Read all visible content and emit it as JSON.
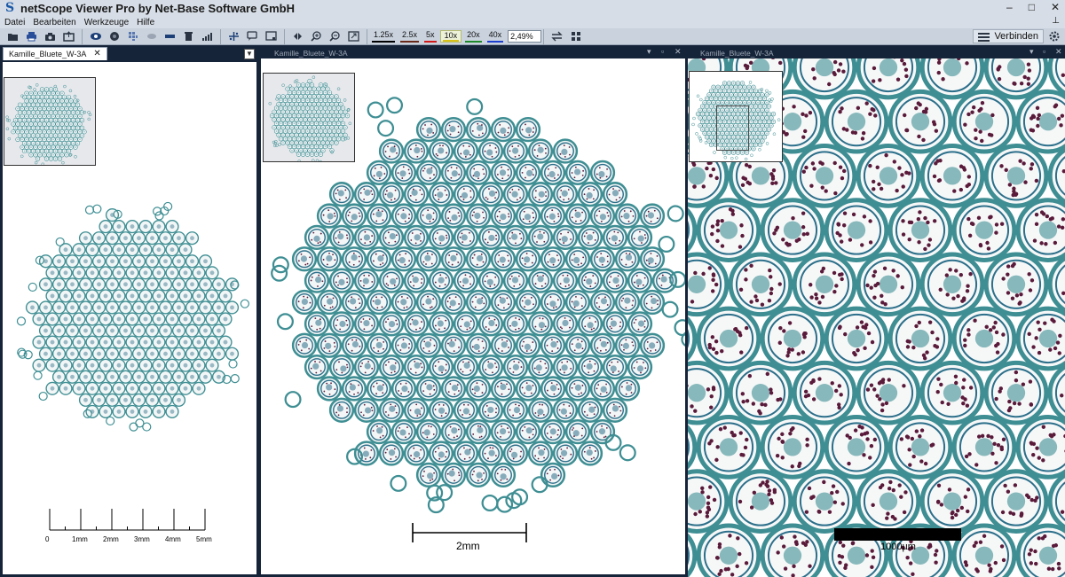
{
  "app": {
    "title": "netScope Viewer Pro by Net-Base Software GmbH",
    "logo_letter": "S",
    "window_buttons": [
      "–",
      "□",
      "✕"
    ]
  },
  "menu": [
    "Datei",
    "Bearbeiten",
    "Werkzeuge",
    "Hilfe"
  ],
  "toolbar": {
    "zoom_levels": [
      {
        "label": "1.25x",
        "color": "#000000",
        "active": false
      },
      {
        "label": "2.5x",
        "color": "#6a2a1a",
        "active": false
      },
      {
        "label": "5x",
        "color": "#d11b1b",
        "active": false
      },
      {
        "label": "10x",
        "color": "#d8c21a",
        "active": true
      },
      {
        "label": "20x",
        "color": "#1f8a2a",
        "active": false
      },
      {
        "label": "40x",
        "color": "#1d3fd0",
        "active": false
      }
    ],
    "zoom_value": "2,49%",
    "connect_label": "Verbinden",
    "icons": [
      "folder-icon",
      "print-icon",
      "camera-icon",
      "export-icon",
      "eye-icon",
      "circle-icon",
      "grid-icon",
      "layers-icon",
      "bar-icon",
      "trash-icon",
      "chart-icon",
      "move-icon",
      "annotate-icon",
      "crop-icon",
      "rotate-icon",
      "zoom-in-icon",
      "zoom-out-icon",
      "fit-icon",
      "swap-icon",
      "layout-icon",
      "connect-icon",
      "settings-icon"
    ]
  },
  "panels": {
    "left": {
      "tab_label": "Kamille_Bluete_W-3A",
      "scale_labels": [
        "0",
        "1mm",
        "2mm",
        "3mm",
        "4mm",
        "5mm"
      ]
    },
    "middle": {
      "tab_label": "Kamille_Bluete_W-3A",
      "scale_label": "2mm"
    },
    "right": {
      "tab_label": "Kamille_Bluete_W-3A",
      "scale_label": "1000µm"
    },
    "header_controls": [
      "▾",
      "▫",
      "✕"
    ]
  },
  "colors": {
    "chrome": "#c9d2dd",
    "frame": "#16243a",
    "tissue_outer": "#3e8e93",
    "tissue_inner": "#2c6f8a",
    "stain_dark": "#5a1a3a"
  }
}
